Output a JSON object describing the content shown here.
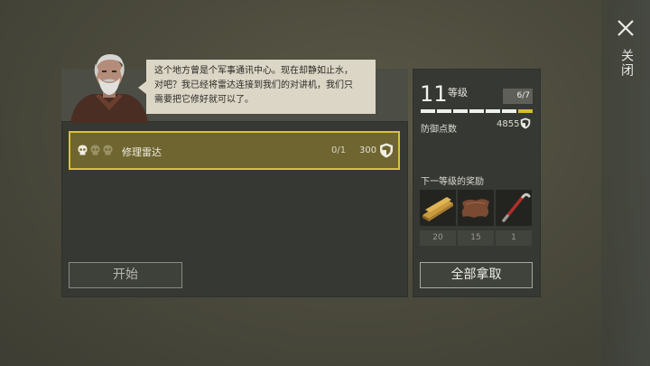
{
  "close": {
    "label": "关闭",
    "icon": "close-icon"
  },
  "dialog": {
    "speaker_icon": "old-man-portrait",
    "text_lines": [
      "这个地方曾是个军事通讯中心。现在却静如止水，",
      "对吧？我已经将雷达连接到我们的对讲机，我们只",
      "需要把它修好就可以了。"
    ]
  },
  "task": {
    "name": "修理雷达",
    "progress": "0/1",
    "points": "300",
    "difficulty_skulls": 3,
    "highlight_color": "#d8c23c"
  },
  "start_button": {
    "label": "开始"
  },
  "level": {
    "number": "11",
    "label": "等级",
    "progress_text": "6/7",
    "segments_filled": 6,
    "segments_total": 7
  },
  "defense": {
    "label": "防御点数",
    "value": "4855"
  },
  "next_rewards": {
    "label": "下一等级的奖励",
    "items": [
      {
        "icon": "wood-planks-icon",
        "count": "20"
      },
      {
        "icon": "leather-icon",
        "count": "15"
      },
      {
        "icon": "crowbar-icon",
        "count": "1"
      }
    ]
  },
  "claim_button": {
    "label": "全部拿取"
  }
}
